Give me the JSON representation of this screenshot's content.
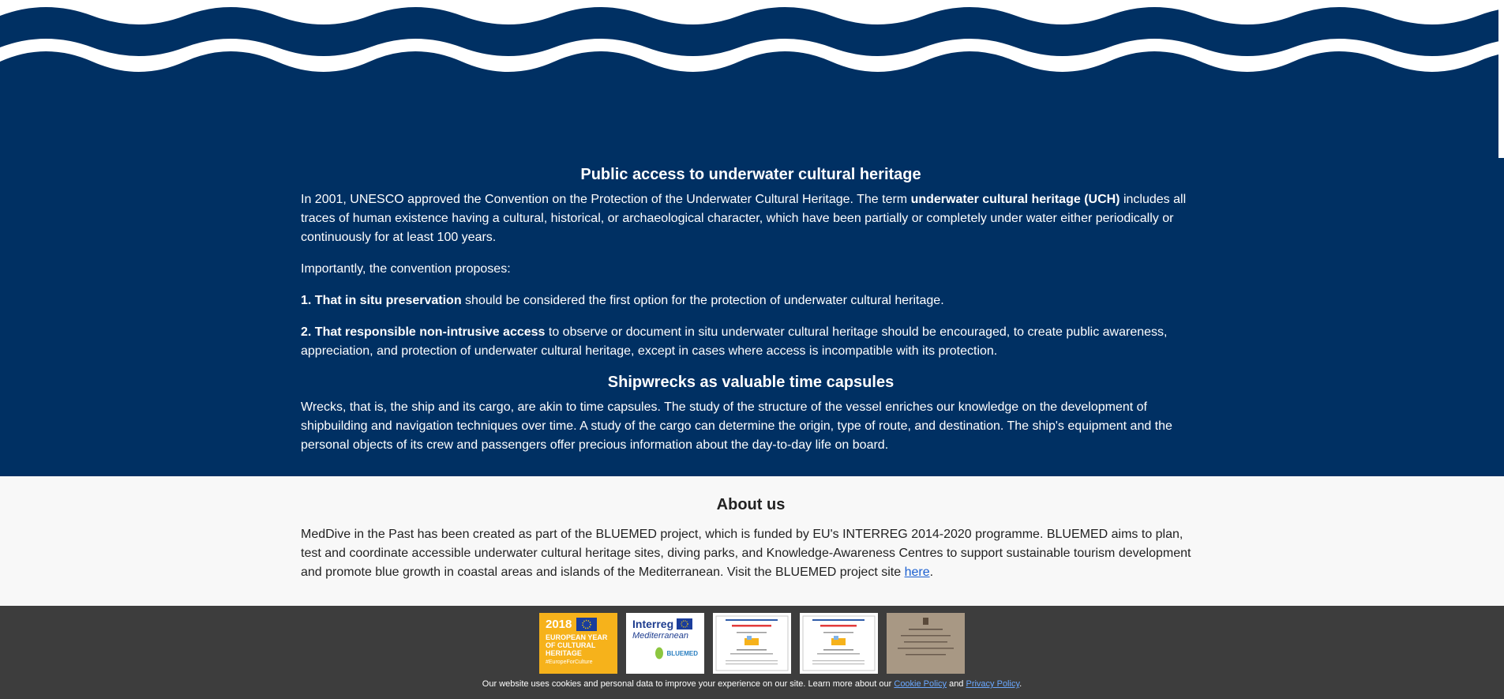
{
  "section1": {
    "title": "Public access to underwater cultural heritage",
    "p1_a": "In 2001, UNESCO approved the Convention on the Protection of the Underwater Cultural Heritage. The term ",
    "p1_b": "underwater cultural heritage (UCH)",
    "p1_c": " includes all traces of human existence having a cultural, historical, or archaeological character, which have been partially or completely under water either periodically or continuously for at least 100 years.",
    "p2": "Importantly, the convention proposes:",
    "p3_b": "1. That in situ preservation",
    "p3_c": " should be considered the first option for the protection of underwater cultural heritage.",
    "p4_b": "2. That responsible non-intrusive access",
    "p4_c": " to observe or document in situ underwater cultural heritage should be encouraged, to create public awareness, appreciation, and protection of underwater cultural heritage, except in cases where access is incompatible with its protection."
  },
  "section2": {
    "title": "Shipwrecks as valuable time capsules",
    "p1": "Wrecks, that is, the ship and its cargo, are akin to time capsules. The study of the structure of the vessel enriches our knowledge on the development of shipbuilding and navigation techniques over time. A study of the cargo can determine the origin, type of route, and destination. The ship's equipment and the personal objects of its crew and passengers offer precious information about the day-to-day life on board."
  },
  "about": {
    "title": "About us",
    "text": "MedDive in the Past has been created as part of the BLUEMED project, which is funded by EU's INTERREG 2014-2020 programme. BLUEMED aims to plan, test and coordinate accessible underwater cultural heritage sites, diving parks, and Knowledge-Awareness Centres to support sustainable tourism development and promote blue growth in coastal areas and islands of the Mediterranean. Visit the BLUEMED project site ",
    "link": "here",
    "end": "."
  },
  "logos": {
    "eych": {
      "year": "2018",
      "l1": "EUROPEAN YEAR",
      "l2": "OF CULTURAL",
      "l3": "HERITAGE",
      "tag": "#EuropeForCulture"
    },
    "interreg": {
      "name": "Interreg",
      "region": "Mediterranean",
      "project": "BLUEMED"
    }
  },
  "cookie": {
    "text": "Our website uses cookies and personal data to improve your experience on our site. Learn more about our ",
    "cookie_link": "Cookie Policy",
    "and": " and ",
    "privacy_link": "Privacy Policy",
    "end": "."
  },
  "colors": {
    "navy": "#003063",
    "footer": "#3d3d3d",
    "eych_yellow": "#f6b21b"
  }
}
